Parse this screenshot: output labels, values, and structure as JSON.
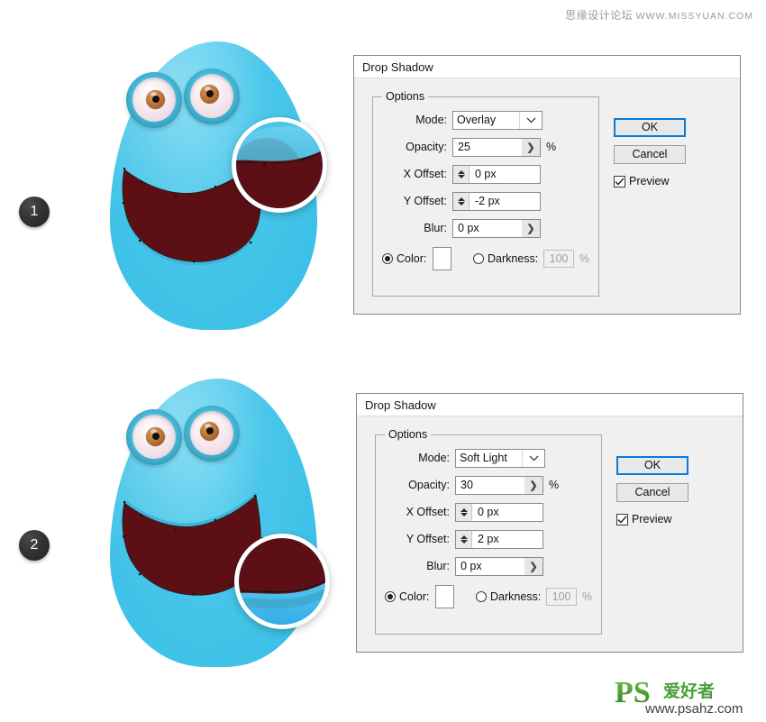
{
  "watermarks": {
    "top_cn": "思缘设计论坛",
    "top_url": "WWW.MISSYUAN.COM",
    "logo_ps": "PS",
    "logo_cn": "爱好者",
    "logo_url": "www.psahz.com"
  },
  "steps": [
    {
      "badge": "1"
    },
    {
      "badge": "2"
    }
  ],
  "colors": {
    "body": "#4ac6ea",
    "mouth": "#5c1016",
    "mouth_rim": "#3fb4d6",
    "iris": "#c07c3c",
    "accent_focus": "#0a7bd6",
    "dialog_bg": "#f0f0f0",
    "logo_green": "#4a9e3c"
  },
  "dialogs": [
    {
      "title": "Drop Shadow",
      "group_legend": "Options",
      "fields": {
        "mode_label": "Mode:",
        "mode_value": "Overlay",
        "mode_options": [
          "Overlay"
        ],
        "opacity_label": "Opacity:",
        "opacity_value": "25",
        "opacity_unit": "%",
        "x_offset_label": "X Offset:",
        "x_offset_value": "0 px",
        "y_offset_label": "Y Offset:",
        "y_offset_value": "-2 px",
        "blur_label": "Blur:",
        "blur_value": "0 px",
        "color_label": "Color:",
        "color_selected": true,
        "color_swatch": "#ffffff",
        "darkness_label": "Darkness:",
        "darkness_value": "100",
        "darkness_unit": "%",
        "darkness_selected": false
      },
      "buttons": {
        "ok": "OK",
        "cancel": "Cancel",
        "preview": "Preview",
        "preview_checked": true
      }
    },
    {
      "title": "Drop Shadow",
      "group_legend": "Options",
      "fields": {
        "mode_label": "Mode:",
        "mode_value": "Soft Light",
        "mode_options": [
          "Soft Light"
        ],
        "opacity_label": "Opacity:",
        "opacity_value": "30",
        "opacity_unit": "%",
        "x_offset_label": "X Offset:",
        "x_offset_value": "0 px",
        "y_offset_label": "Y Offset:",
        "y_offset_value": "2 px",
        "blur_label": "Blur:",
        "blur_value": "0 px",
        "color_label": "Color:",
        "color_selected": true,
        "color_swatch": "#ffffff",
        "darkness_label": "Darkness:",
        "darkness_value": "100",
        "darkness_unit": "%",
        "darkness_selected": false
      },
      "buttons": {
        "ok": "OK",
        "cancel": "Cancel",
        "preview": "Preview",
        "preview_checked": true
      }
    }
  ]
}
